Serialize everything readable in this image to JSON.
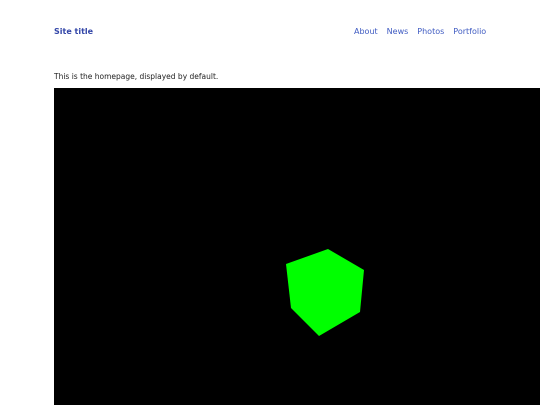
{
  "header": {
    "site_title": "Site title",
    "nav": [
      {
        "label": "About"
      },
      {
        "label": "News"
      },
      {
        "label": "Photos"
      },
      {
        "label": "Portfolio"
      }
    ]
  },
  "main": {
    "intro_text": "This is the homepage, displayed by default."
  },
  "scene": {
    "background_color": "#000000",
    "object": "cube",
    "object_color": "#00ff00"
  }
}
